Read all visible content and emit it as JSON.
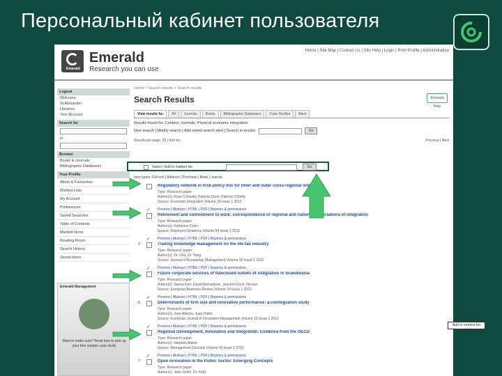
{
  "slide": {
    "title": "Персональный кабинет пользователя"
  },
  "site": {
    "brand_badge": "Emerald",
    "name": "Emerald",
    "tagline": "Research you can use",
    "topnav": "Home | Site Map | Contact Us | Site Help | Login | Print Profile | Administration"
  },
  "sidebar": {
    "login_head": "Logout",
    "welcome_lines": [
      "Welcome",
      "St Alexander",
      "Libraries"
    ],
    "account": "Your Account",
    "search_head": "Search for",
    "in_label": "in:",
    "browse_head": "Browse",
    "browse_items": [
      "Books & Journals",
      "Bibliographic Databases"
    ],
    "menu_head": "Your Profile",
    "menu_items": [
      "Alerts & Favourites",
      "Marked Lists",
      "My Account",
      "Preferences",
      "Saved Searches",
      "Table of Contents",
      "Marked Items",
      "Reading Room",
      "Search History",
      "Saved items"
    ],
    "promo_head": "Emerald Management",
    "promo_text": "Want to make sure? Read how to pick up your free sample case study"
  },
  "main": {
    "breadcrumb": "Home > Search results > Search results",
    "title": "Search Results",
    "help": "Emerald Help",
    "tabs": [
      "View results for",
      "All",
      "Journals",
      "Books",
      "Bibliographic Databases",
      "Case Studies",
      "Back"
    ],
    "active_tab": 0,
    "results_count": "Results found for: Content: Journals; Physical economic integration",
    "search_again": "New search | Modify search | Add saved search alert | Search in results:",
    "search_button": "Go",
    "controls_left": "Results per page: 20 | Sort by:",
    "controls_right": "Previous | Next",
    "select_bar": "Select | Add to marked list",
    "select_button": "Go",
    "legend": "Item types: Full text | Abstract | Purchase | Book | Journal"
  },
  "results": [
    {
      "num": "",
      "title": "Regulatory network in Irish policy mix for inner and outer cross-regional integration",
      "meta1": "Type: Research paper",
      "meta2": "Author(s): Rose Connolly, Patricia Dunn, Patricia O'Reilly",
      "meta3": "Source: Economic Integration Volume 34 Issue 1 2012",
      "links": "Preview | Abstract | HTML | PDF | Reprints & permissions"
    },
    {
      "num": "",
      "title": "Retirement and commitment to work: correspondence of regional and national expectations of integration",
      "meta1": "Type: Research paper",
      "meta2": "Author(s): Katherine Dunn",
      "meta3": "Source: Employee Relations Volume 34 Issue 1 2012",
      "links": "Preview | Abstract | HTML | PDF | Reprints & permissions"
    },
    {
      "num": "2",
      "title": "Trading knowledge management on the life-fab industry",
      "meta1": "Type: Research paper",
      "meta2": "Author(s): Dr. Chu, Dr. Yang",
      "meta3": "Source: Journal of Knowledge Management Volume 16 Issue 1 2012",
      "links": "Preview | Abstract | HTML | PDF | Reprints & permissions"
    },
    {
      "num": "",
      "title": "Future corporate services of franchised outlets of integration in Scandinavia",
      "meta1": "Type: Research paper",
      "meta2": "Author(s): Sanna Kerl, David Richardson, Joachim Koch, Nicolas",
      "meta3": "Source: European Business Review Volume 24 Issue 1 2012",
      "links": "Preview | Abstract | HTML | PDF | Reprints & permissions"
    },
    {
      "num": "5",
      "title": "Determinants of firm size and innovative performance: a cointegration study",
      "meta1": "Type: Research paper",
      "meta2": "Author(s): Jose Alberto, Juan Pablo",
      "meta3": "Source: European Journal of Innovation Management Volume 15 Issue 1 2012",
      "links": "Preview | Abstract | HTML | PDF | Reprints & permissions"
    },
    {
      "num": "",
      "title": "Regional Development, Innovation and Integration: Evidence from the OECD",
      "meta1": "Type: Research paper",
      "meta2": "Author(s): Stephen Martin",
      "meta3": "Source: Management Decision Volume 50 Issue 1 2012",
      "links": "Preview | Abstract | HTML | PDF | Reprints & permissions"
    },
    {
      "num": "7",
      "title": "Open innovation in the Public Sector: Emerging Concepts",
      "meta1": "Type: Research paper",
      "meta2": "Author(s): John Smith, Dr. Kelly",
      "meta3": "",
      "links": ""
    }
  ],
  "corner_label": "Add to marked list",
  "colors": {
    "slide_bg": "#0e4a3e",
    "arrow_green": "#46c46e",
    "link_blue": "#1a4fa0"
  }
}
